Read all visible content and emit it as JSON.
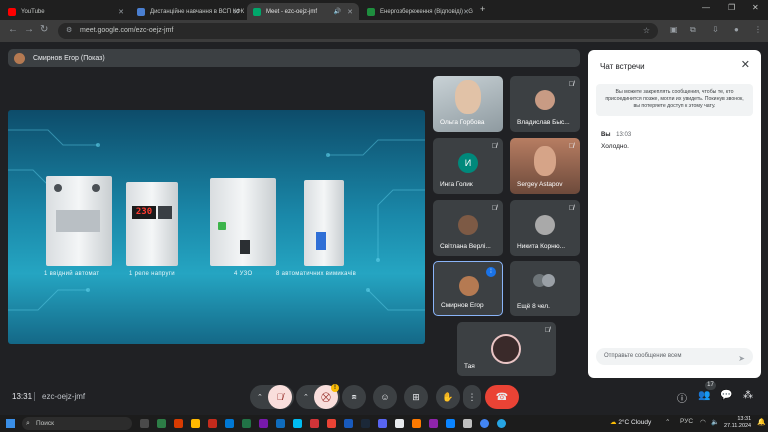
{
  "browser": {
    "tabs": [
      {
        "label": "YouTube",
        "fav_color": "#ff0000"
      },
      {
        "label": "Дистанційне навчання в ВСП КФК",
        "fav_color": "#4a7fd1"
      },
      {
        "label": "Meet - ezc-oejz-jmf",
        "fav_color": "#00a86b"
      },
      {
        "label": "Енергозбереження (Відповіді) - G",
        "fav_color": "#1e8e3e"
      }
    ],
    "new_tab": "+",
    "url": "meet.google.com/ezc-oejz-jmf"
  },
  "presenter": {
    "label": "Смирнов Егор (Показ)"
  },
  "slide": {
    "captions": [
      "1 ввідний автомат",
      "1 реле напруги",
      "4 УЗО",
      "8 автоматичних вимикачів"
    ],
    "relay_display": "230"
  },
  "participants": [
    {
      "name": "Ольга Горбова",
      "initial": ""
    },
    {
      "name": "Владислав Быс...",
      "initial": ""
    },
    {
      "name": "Инга Голик",
      "initial": "И"
    },
    {
      "name": "Sergey Astapov",
      "initial": ""
    },
    {
      "name": "Світлана Верлі...",
      "initial": ""
    },
    {
      "name": "Никита Корню...",
      "initial": ""
    },
    {
      "name": "Смирнов Егор",
      "initial": ""
    },
    {
      "name": "Ещё 8 чел.",
      "initial": ""
    },
    {
      "name": "Тая",
      "initial": ""
    }
  ],
  "chat": {
    "title": "Чат встречи",
    "notice": "Вы можете закреплять сообщения, чтобы те, кто присоединится позже, могли их увидеть. Покинув звонок, вы потеряете доступ к этому чату.",
    "message": {
      "sender": "Вы",
      "time": "13:03",
      "text": "Холодно."
    },
    "input_placeholder": "Отправьте сообщение всем"
  },
  "meeting": {
    "time": "13:31",
    "code": "ezc-oejz-jmf",
    "participant_count": "17",
    "alert_badge": "!"
  },
  "taskbar": {
    "search_placeholder": "Поиск",
    "weather": "2°C  Cloudy",
    "lang": "РУС",
    "clock_time": "13:31",
    "clock_date": "27.11.2024"
  },
  "colors": {
    "accent": "#8ab4f8",
    "leave": "#ea4335",
    "muted": "#f9dedc"
  }
}
